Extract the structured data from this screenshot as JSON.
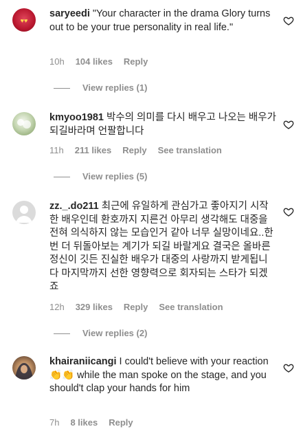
{
  "comments": [
    {
      "username": "saryeedi",
      "text": "\"Your character in the drama Glory turns out to be your true personality in real life.\"",
      "time": "10h",
      "likes": "104 likes",
      "reply": "Reply",
      "translate": "",
      "view_replies": "View replies (1)"
    },
    {
      "username": "kmyoo1981",
      "text": "박수의 의미를 다시 배우고 나오는 배우가 되길바라며 언팔합니다",
      "time": "11h",
      "likes": "211 likes",
      "reply": "Reply",
      "translate": "See translation",
      "view_replies": "View replies (5)"
    },
    {
      "username": "zz._.do211",
      "text": "최근에 유일하게 관심가고 좋아지기 시작한 배우인데 환호까지 지른건 아무리 생각해도 대중을 전혀 의식하지 않는 모습인거 같아 너무 실망이네요..한 번 더 뒤돌아보는 계기가 되길 바랄게요 결국은 올바른 정신이 깃든 진실한 배우가 대중의 사랑까지 받게됩니다 마지막까지 선한 영향력으로 회자되는 스타가 되겠죠",
      "time": "12h",
      "likes": "329 likes",
      "reply": "Reply",
      "translate": "See translation",
      "view_replies": "View replies (2)"
    },
    {
      "username": "khairaniicangi",
      "text": "I could't believe with your reaction 👏👏 while the man spoke on the stage, and you should't clap your hands for him",
      "time": "7h",
      "likes": "8 likes",
      "reply": "Reply",
      "translate": "",
      "view_replies": ""
    }
  ],
  "icons": {
    "like": "heart-outline-icon"
  },
  "colors": {
    "text": "#262626",
    "secondary": "#8e8e8e"
  }
}
